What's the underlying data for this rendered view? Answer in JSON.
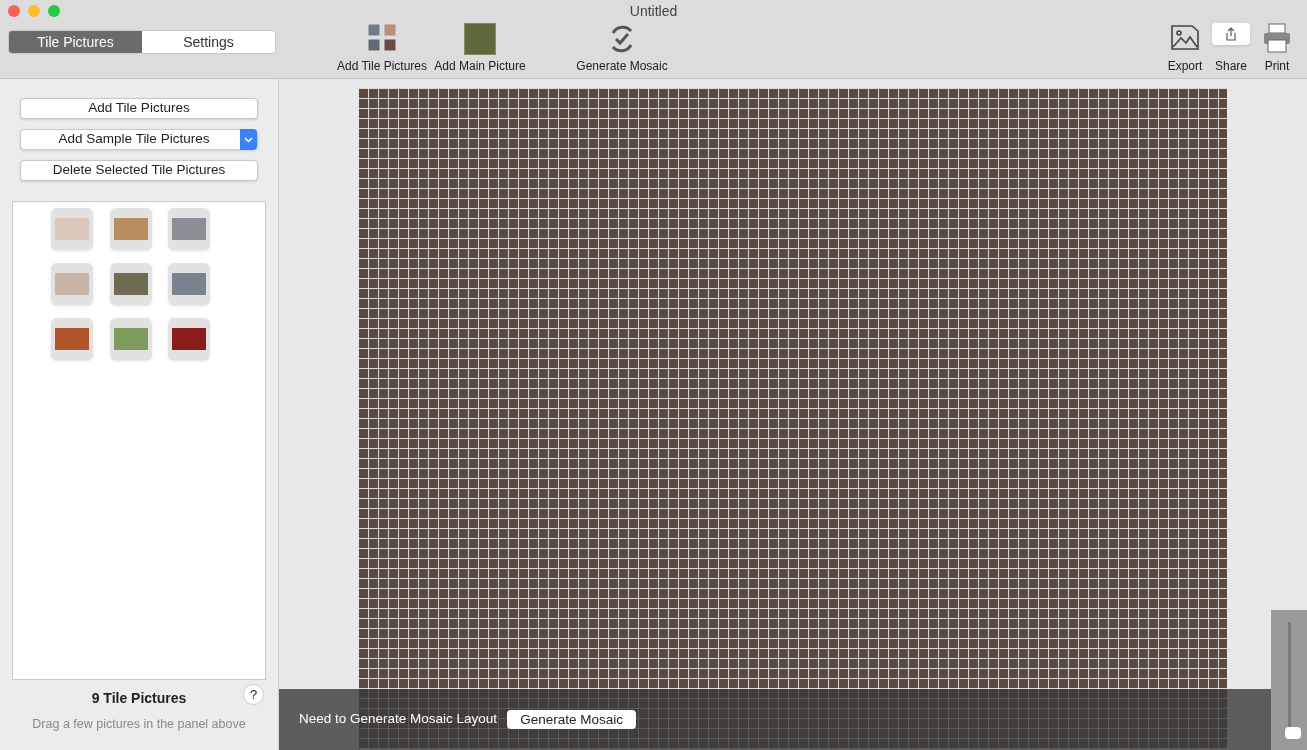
{
  "window": {
    "title": "Untitled"
  },
  "tabs": [
    {
      "label": "Tile Pictures",
      "selected": true
    },
    {
      "label": "Settings",
      "selected": false
    }
  ],
  "toolbar": {
    "left": [
      {
        "label": "Add Tile Pictures",
        "kind": "tiles"
      },
      {
        "label": "Add Main Picture",
        "kind": "painting"
      },
      {
        "label": "Generate Mosaic",
        "kind": "refresh"
      }
    ],
    "right": [
      {
        "label": "Export",
        "kind": "export"
      },
      {
        "label": "Share",
        "kind": "share"
      },
      {
        "label": "Print",
        "kind": "print"
      }
    ]
  },
  "sidebar": {
    "buttons": [
      {
        "label": "Add Tile Pictures",
        "kind": "plain"
      },
      {
        "label": "Add Sample Tile Pictures",
        "kind": "popup"
      },
      {
        "label": "Delete Selected Tile Pictures",
        "kind": "plain"
      }
    ],
    "tiles": [
      {
        "selected": false
      },
      {
        "selected": false
      },
      {
        "selected": false
      },
      {
        "selected": false
      },
      {
        "selected": false
      },
      {
        "selected": false
      },
      {
        "selected": false
      },
      {
        "selected": false
      },
      {
        "selected": false
      }
    ],
    "count_label": "9 Tile Pictures",
    "help": "?",
    "hint": "Drag a few pictures in the panel above"
  },
  "banner": {
    "message": "Need to Generate Mosaic Layout",
    "button": "Generate Mosaic"
  },
  "zoom_slider": {
    "level": 0.04
  }
}
